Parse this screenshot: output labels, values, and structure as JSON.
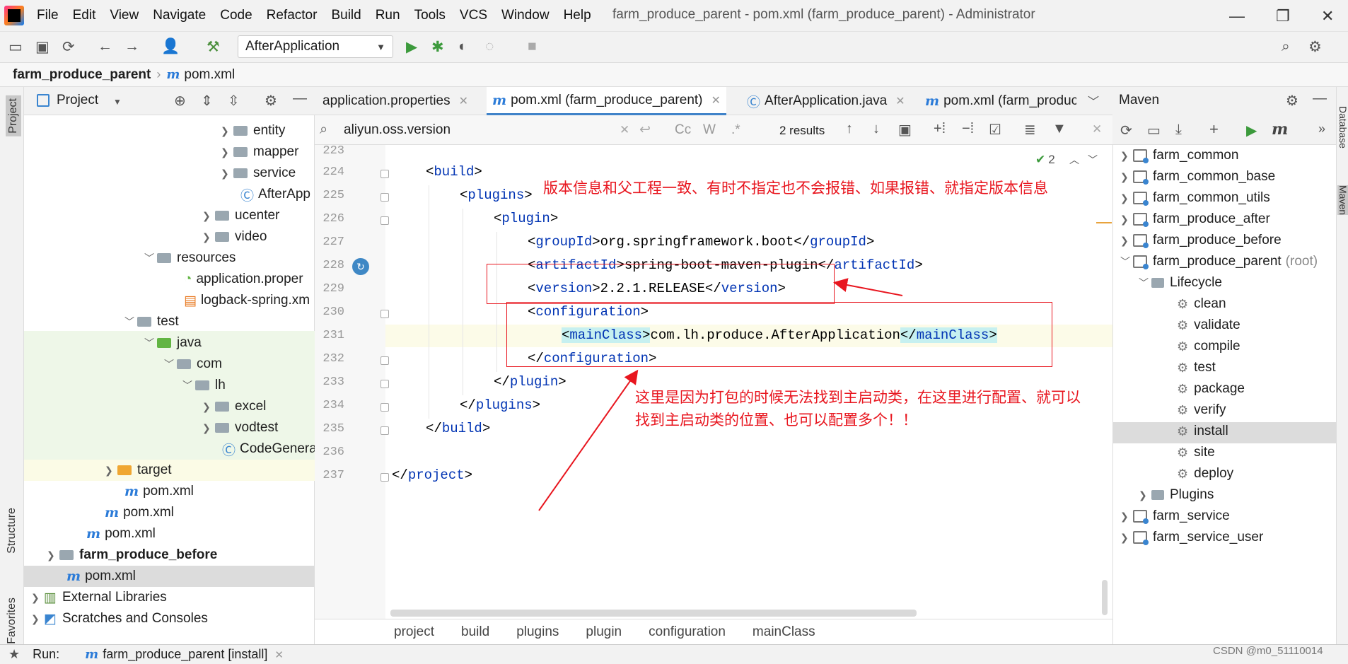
{
  "menu": [
    "File",
    "Edit",
    "View",
    "Navigate",
    "Code",
    "Refactor",
    "Build",
    "Run",
    "Tools",
    "VCS",
    "Window",
    "Help"
  ],
  "window_title": "farm_produce_parent - pom.xml (farm_produce_parent) - Administrator",
  "run_config": "AfterApplication",
  "nav": {
    "project": "farm_produce_parent",
    "file": "pom.xml"
  },
  "left_strip": {
    "project": "Project",
    "structure": "Structure",
    "favorites": "Favorites"
  },
  "project_panel": {
    "title": "Project",
    "tree": [
      {
        "label": "entity",
        "icon": "folder"
      },
      {
        "label": "mapper",
        "icon": "folder"
      },
      {
        "label": "service",
        "icon": "folder"
      },
      {
        "label": "AfterApp",
        "icon": "class-icon"
      },
      {
        "label": "ucenter",
        "icon": "folder"
      },
      {
        "label": "video",
        "icon": "folder"
      },
      {
        "label": "resources",
        "icon": "folder"
      },
      {
        "label": "application.proper",
        "icon": "properties-icon"
      },
      {
        "label": "logback-spring.xm",
        "icon": "xml-icon"
      },
      {
        "label": "test",
        "icon": "folder"
      },
      {
        "label": "java",
        "icon": "folder"
      },
      {
        "label": "com",
        "icon": "folder"
      },
      {
        "label": "lh",
        "icon": "folder"
      },
      {
        "label": "excel",
        "icon": "folder"
      },
      {
        "label": "vodtest",
        "icon": "folder"
      },
      {
        "label": "CodeGenera",
        "icon": "class-icon"
      },
      {
        "label": "target",
        "icon": "folder"
      },
      {
        "label": "pom.xml",
        "icon": "maven-icon"
      },
      {
        "label": "pom.xml",
        "icon": "maven-icon"
      },
      {
        "label": "pom.xml",
        "icon": "maven-icon"
      },
      {
        "label": "farm_produce_before",
        "icon": "folder"
      },
      {
        "label": "pom.xml",
        "icon": "maven-icon"
      },
      {
        "label": "External Libraries",
        "icon": "library-icon"
      },
      {
        "label": "Scratches and Consoles",
        "icon": "scratch-icon"
      }
    ]
  },
  "tabs": [
    {
      "label": "application.properties"
    },
    {
      "label": "pom.xml (farm_produce_parent)"
    },
    {
      "label": "AfterApplication.java"
    },
    {
      "label": "pom.xml (farm_produc"
    }
  ],
  "search": {
    "query": "aliyun.oss.version",
    "results": "2 results",
    "cc": "Cc",
    "w": "W",
    "regex": ".*"
  },
  "inspections": "2",
  "code_lines": [
    {
      "num": "223",
      "text": ""
    },
    {
      "num": "224",
      "open": "build"
    },
    {
      "num": "225",
      "open": "plugins"
    },
    {
      "num": "226",
      "open": "plugin"
    },
    {
      "num": "227",
      "tag": "groupId",
      "value": "org.springframework.boot"
    },
    {
      "num": "228",
      "tag": "artifactId",
      "value": "spring-boot-maven-plugin"
    },
    {
      "num": "229",
      "tag": "version",
      "value": "2.2.1.RELEASE"
    },
    {
      "num": "230",
      "open": "configuration"
    },
    {
      "num": "231",
      "tag": "mainClass",
      "value": "com.lh.produce.AfterApplication"
    },
    {
      "num": "232",
      "close": "configuration"
    },
    {
      "num": "233",
      "close": "plugin"
    },
    {
      "num": "234",
      "close": "plugins"
    },
    {
      "num": "235",
      "close": "build"
    },
    {
      "num": "236",
      "text": ""
    },
    {
      "num": "237",
      "close": "project"
    }
  ],
  "annotations": {
    "top": "版本信息和父工程一致、有时不指定也不会报错、如果报错、就指定版本信息",
    "bottom_line1": "这里是因为打包的时候无法找到主启动类，在这里进行配置、就可以",
    "bottom_line2": "找到主启动类的位置、也可以配置多个！！"
  },
  "breadcrumb": [
    "project",
    "build",
    "plugins",
    "plugin",
    "configuration",
    "mainClass"
  ],
  "maven": {
    "title": "Maven",
    "modules": [
      "farm_common",
      "farm_common_base",
      "farm_common_utils",
      "farm_produce_after",
      "farm_produce_before"
    ],
    "parent": "farm_produce_parent",
    "parent_suffix": "(root)",
    "lifecycle_label": "Lifecycle",
    "lifecycle": [
      "clean",
      "validate",
      "compile",
      "test",
      "package",
      "verify",
      "install",
      "site",
      "deploy"
    ],
    "plugins_label": "Plugins",
    "more_modules": [
      "farm_service",
      "farm_service_user"
    ]
  },
  "right_strip": {
    "database": "Database",
    "maven": "Maven"
  },
  "bottom": {
    "run_label": "Run:",
    "run_tab": "farm_produce_parent [install]"
  },
  "watermark": "CSDN @m0_51110014",
  "colors": {
    "accent": "#4083c9",
    "annotation": "#e8161f",
    "tag": "#0033b3"
  }
}
